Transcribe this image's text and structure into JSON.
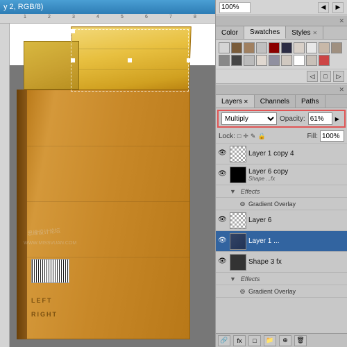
{
  "title_bar": {
    "text": "y 2, RGB/8)"
  },
  "zoom_bar": {
    "value": "100%",
    "buttons": [
      "◀",
      "▶"
    ]
  },
  "swatches_panel": {
    "tabs": [
      {
        "label": "Color",
        "active": false,
        "closable": false
      },
      {
        "label": "Swatches",
        "active": true,
        "closable": false
      },
      {
        "label": "Styles",
        "active": false,
        "closable": true
      }
    ],
    "swatches": [
      {
        "color": "#d4d4d4"
      },
      {
        "color": "#7a5c3a"
      },
      {
        "color": "#a08060"
      },
      {
        "color": "#c0c0c0"
      },
      {
        "color": "#8b0000"
      },
      {
        "color": "#2c2c44"
      },
      {
        "color": "#e8e8e8"
      },
      {
        "color": "#c8b8a8"
      },
      {
        "color": "#a09080"
      },
      {
        "color": "#888888"
      },
      {
        "color": "#444444"
      },
      {
        "color": "#bbbbbb"
      },
      {
        "color": "#e0d8d0"
      },
      {
        "color": "#9090a0"
      },
      {
        "color": "#d0c8c0"
      },
      {
        "color": "#ffffff"
      },
      {
        "color": "#c8c0b8"
      },
      {
        "color": "#cc4444"
      }
    ],
    "footer_buttons": [
      "◁",
      "□",
      "▷"
    ]
  },
  "layers_panel": {
    "tabs": [
      {
        "label": "Layers",
        "active": true,
        "closable": true
      },
      {
        "label": "Channels",
        "active": false,
        "closable": false
      },
      {
        "label": "Paths",
        "active": false,
        "closable": false
      }
    ],
    "blend_mode": "Multiply",
    "opacity_label": "Opacity:",
    "opacity_value": "61%",
    "lock_label": "Lock:",
    "fill_label": "Fill:",
    "fill_value": "100%",
    "layers": [
      {
        "id": "layer-1-copy-4",
        "visible": true,
        "thumb_type": "checker",
        "name": "Layer 1 copy 4",
        "has_fx": false,
        "selected": false,
        "effects": []
      },
      {
        "id": "layer-6-copy",
        "visible": true,
        "thumb_type": "black",
        "name": "Layer 6 copy",
        "has_fx": true,
        "selected": false,
        "effects": [
          "Shape ...fx"
        ]
      },
      {
        "id": "effects-1",
        "type": "effects-group",
        "items": [
          "Effects",
          "Gradient Overlay"
        ]
      },
      {
        "id": "layer-6",
        "visible": true,
        "thumb_type": "checker",
        "name": "Layer 6",
        "has_fx": false,
        "selected": false,
        "effects": []
      },
      {
        "id": "layer-1",
        "visible": true,
        "thumb_type": "blue",
        "name": "Layer 1 ...",
        "has_fx": false,
        "selected": true,
        "effects": []
      },
      {
        "id": "shape-3",
        "visible": true,
        "thumb_type": "dark",
        "name": "Shape 3 fx",
        "has_fx": false,
        "selected": false,
        "effects": []
      },
      {
        "id": "effects-2",
        "type": "effects-group",
        "items": [
          "Effects",
          "Gradient Overlay"
        ]
      }
    ],
    "footer_buttons": [
      "◎",
      "fx",
      "□",
      "⊕",
      "☰",
      "🗑"
    ]
  }
}
